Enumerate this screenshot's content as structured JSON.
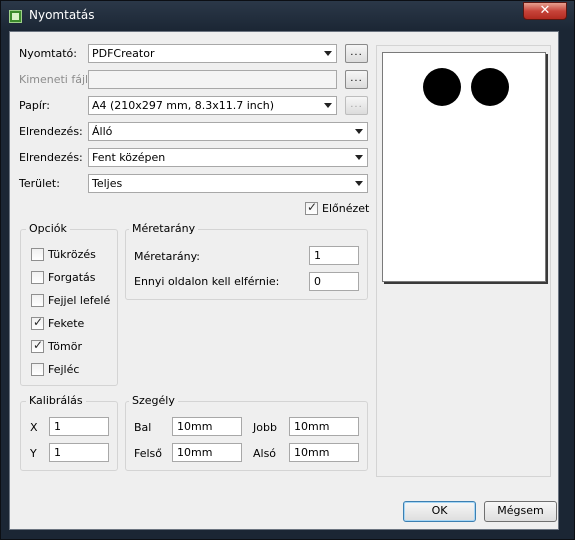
{
  "window": {
    "title": "Nyomtatás",
    "close_label": "✕"
  },
  "form": {
    "printer": {
      "label": "Nyomtató:",
      "value": "PDFCreator",
      "browse": "..."
    },
    "output_file": {
      "label": "Kimeneti fájl:",
      "value": "",
      "browse": "..."
    },
    "paper": {
      "label": "Papír:",
      "value": "A4 (210x297 mm, 8.3x11.7 inch)",
      "browse": "..."
    },
    "orientation": {
      "label": "Elrendezés:",
      "value": "Álló"
    },
    "placement": {
      "label": "Elrendezés:",
      "value": "Fent középen"
    },
    "area": {
      "label": "Terület:",
      "value": "Teljes"
    },
    "preview_toggle": {
      "label": "Előnézet",
      "checked": true
    }
  },
  "options": {
    "title": "Opciók",
    "items": [
      {
        "label": "Tükrözés",
        "checked": false
      },
      {
        "label": "Forgatás",
        "checked": false
      },
      {
        "label": "Fejjel lefelé",
        "checked": false
      },
      {
        "label": "Fekete",
        "checked": true
      },
      {
        "label": "Tömör",
        "checked": true
      },
      {
        "label": "Fejléc",
        "checked": false
      }
    ]
  },
  "scale": {
    "title": "Méretarány",
    "scale_label": "Méretarány:",
    "scale_value": "1",
    "fit_label": "Ennyi oldalon kell elférnie:",
    "fit_value": "0"
  },
  "calibration": {
    "title": "Kalibrálás",
    "x_label": "X",
    "x_value": "1",
    "y_label": "Y",
    "y_value": "1"
  },
  "margin": {
    "title": "Szegély",
    "left_label": "Bal",
    "left_value": "10mm",
    "right_label": "Jobb",
    "right_value": "10mm",
    "top_label": "Felső",
    "top_value": "10mm",
    "bottom_label": "Alsó",
    "bottom_value": "10mm"
  },
  "buttons": {
    "ok": "OK",
    "cancel": "Mégsem"
  }
}
